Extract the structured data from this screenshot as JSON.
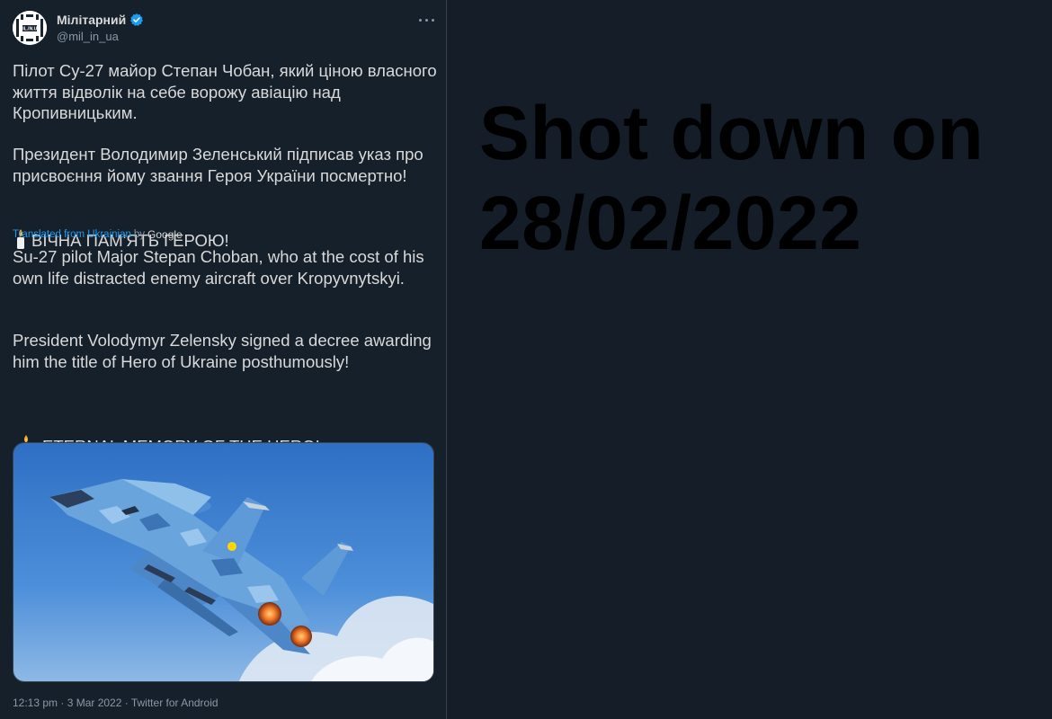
{
  "tweet": {
    "display_name": "Мілітарний",
    "handle": "@mil_in_ua",
    "avatar_text": "MIL.IN.UA",
    "original_text": {
      "p1": "Пілот Су-27 майор Степан Чобан, який ціною власного життя відволік на себе ворожу авіацію над Кропивницьким.",
      "p2": "Президент Володимир Зеленський підписав указ про присвоєння йому звання Героя України посмертно!",
      "p3": "ВІЧНА ПАМ'ЯТЬ ГЕРОЮ!"
    },
    "translation_label": "Translated from Ukrainian",
    "translation_by": "by",
    "translation_provider": "Google",
    "translated_text": {
      "p1": "Su-27 pilot Major Stepan Choban, who at the cost of his own life distracted enemy aircraft over Kropyvnytskyi.",
      "p2": " President Volodymyr Zelensky signed a decree awarding him the title of Hero of Ukraine posthumously!",
      "p3": "ETERNAL MEMORY OF THE HERO!"
    },
    "meta": "12:13 pm · 3 Mar 2022 · Twitter for Android"
  },
  "headline": {
    "line1": "Shot down on",
    "line2": "28/02/2022"
  },
  "colors": {
    "tweet_bg": "#15202b",
    "page_bg": "#151d28",
    "link": "#1d9bf0",
    "verified": "#1d9bf0"
  },
  "icons": [
    "verified-badge-icon",
    "more-options-icon",
    "candle-icon"
  ]
}
